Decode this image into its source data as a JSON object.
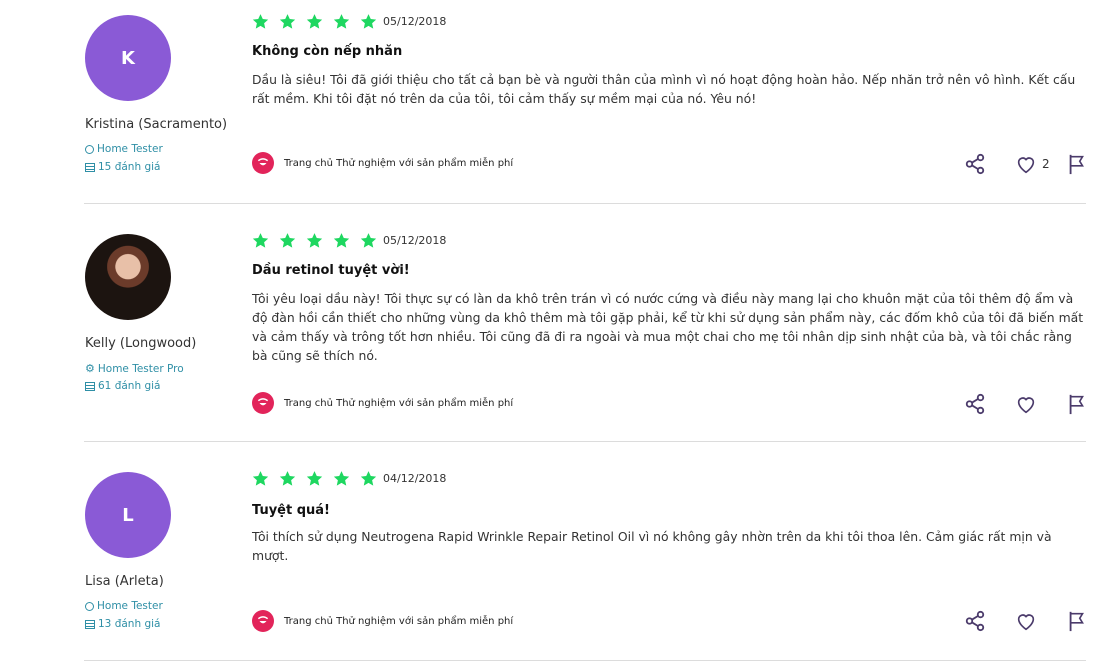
{
  "reviews": [
    {
      "avatar_letter": "K",
      "avatar_color": "#8a5ad6",
      "name": "Kristina (Sacramento)",
      "badge": "Home Tester",
      "review_count": "15 đánh giá",
      "rating": 5,
      "date": "05/12/2018",
      "title": "Không còn nếp nhăn",
      "body": "Dầu là siêu! Tôi đã giới thiệu cho tất cả bạn bè và người thân của mình vì nó hoạt động hoàn hảo. Nếp nhăn trở nên vô hình. Kết cấu rất mềm. Khi tôi đặt nó trên da của tôi, tôi cảm thấy sự mềm mại của nó. Yêu nó!",
      "source": "Trang chủ Thử nghiệm với sản phẩm miễn phí",
      "likes": "2"
    },
    {
      "avatar_letter": "",
      "avatar_color": "",
      "name": "Kelly (Longwood)",
      "badge": "Home Tester Pro",
      "review_count": "61 đánh giá",
      "rating": 5,
      "date": "05/12/2018",
      "title": "Dầu retinol tuyệt vời!",
      "body": "Tôi yêu loại dầu này! Tôi thực sự có làn da khô trên trán vì có nước cứng và điều này mang lại cho khuôn mặt của tôi thêm độ ẩm và độ đàn hồi cần thiết cho những vùng da khô thêm mà tôi gặp phải, kể từ khi sử dụng sản phẩm này, các đốm khô của tôi đã biến mất và cảm thấy và trông tốt hơn nhiều. Tôi cũng đã đi ra ngoài và mua một chai cho mẹ tôi nhân dịp sinh nhật của bà, và tôi chắc rằng bà cũng sẽ thích nó.",
      "source": "Trang chủ Thử nghiệm với sản phẩm miễn phí",
      "likes": ""
    },
    {
      "avatar_letter": "L",
      "avatar_color": "#8a5ad6",
      "name": "Lisa (Arleta)",
      "badge": "Home Tester",
      "review_count": "13 đánh giá",
      "rating": 5,
      "date": "04/12/2018",
      "title": "Tuyệt quá!",
      "body": "Tôi thích sử dụng Neutrogena Rapid Wrinkle Repair Retinol Oil vì nó không gây nhờn trên da khi tôi thoa lên. Cảm giác rất mịn và mượt.",
      "source": "Trang chủ Thử nghiệm với sản phẩm miễn phí",
      "likes": ""
    }
  ],
  "colors": {
    "star": "#1ed760",
    "accent": "#2f8fa6",
    "brand": "#e2245a",
    "icon": "#4b3b6b"
  }
}
